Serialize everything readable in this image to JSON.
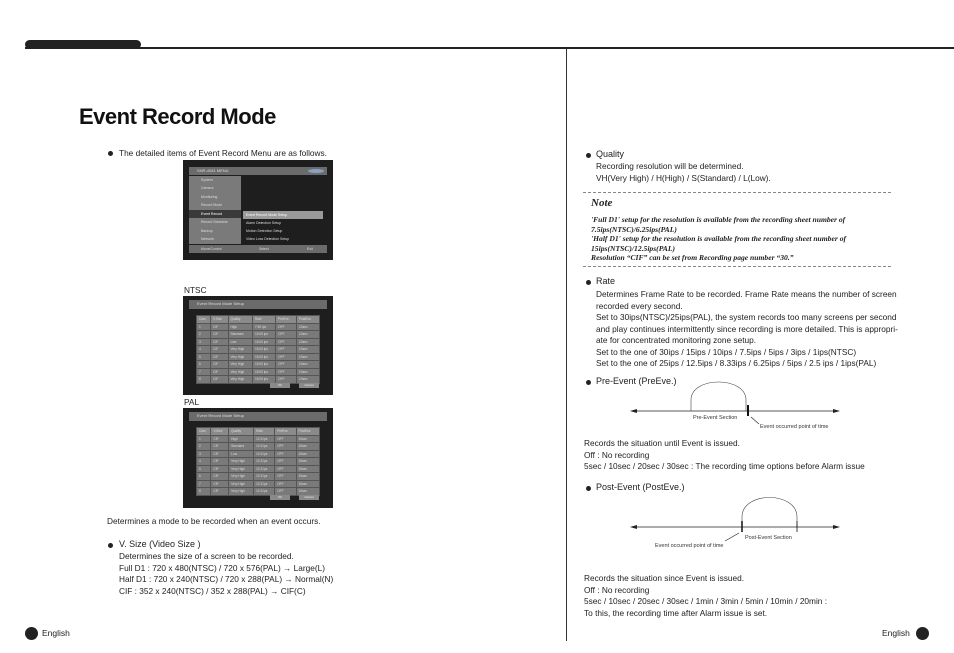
{
  "page": {
    "title": "Event Record Mode",
    "footer_left": "English",
    "footer_right": "English"
  },
  "left": {
    "intro": "The detailed items of Event Record Menu are as follows.",
    "ntsc_label": "NTSC",
    "pal_label": "PAL",
    "determines": "Determines a mode to be recorded when an event occurs.",
    "vsize_title": "V. Size (Video Size )",
    "vsize_lines": [
      "Determines the size of a screen to be recorded.",
      "Full D1 : 720 x 480(NTSC) / 720 x 576(PAL) → Large(L)",
      "Half D1 : 720 x 240(NTSC) / 720 x 288(PAL)  → Normal(N)",
      "CIF : 352 x 240(NTSC) / 352 x 288(PAL) → CIF(C)"
    ]
  },
  "menu_screen": {
    "title": "SHR-4081 MENU",
    "items": [
      "System",
      "Camera",
      "Monitoring",
      "Record Mode",
      "Event Record",
      "Record Schedule",
      "Backup",
      "Network"
    ],
    "selected": "Event Record",
    "submenu": [
      "Event Record Mode Setup",
      "Alarm Detection Setup",
      "Motion Detection Setup",
      "Video Loss Detection Setup"
    ],
    "footer": [
      "Move/Control",
      "Select",
      "Exit"
    ]
  },
  "setup_screens": {
    "title": "Event Record Mode Setup",
    "columns": [
      "Cam",
      "V.Size",
      "Quality",
      "Rate",
      "PreEve.",
      "PostEve."
    ],
    "ok": "OK",
    "cancel": "Cancel",
    "ntsc_rows": [
      [
        "1",
        "CIF",
        "High",
        "7.50 ips",
        "OFF",
        "10sec"
      ],
      [
        "2",
        "CIF",
        "Standard",
        "15.00 ips",
        "OFF",
        "10sec"
      ],
      [
        "3",
        "CIF",
        "Low",
        "15.00 ips",
        "OFF",
        "10sec"
      ],
      [
        "4",
        "CIF",
        "Very High",
        "15.00 ips",
        "OFF",
        "10sec"
      ],
      [
        "5",
        "CIF",
        "Very High",
        "15.00 ips",
        "OFF",
        "10sec"
      ],
      [
        "6",
        "CIF",
        "Very High",
        "15.00 ips",
        "OFF",
        "10sec"
      ],
      [
        "7",
        "CIF",
        "Very High",
        "15.00 ips",
        "OFF",
        "10sec"
      ],
      [
        "8",
        "CIF",
        "Very High",
        "15.00 ips",
        "OFF",
        "10sec"
      ]
    ],
    "pal_rows": [
      [
        "1",
        "CIF",
        "High",
        "12.5 ips",
        "OFF",
        "10sec"
      ],
      [
        "2",
        "CIF",
        "Standard",
        "12.5 ips",
        "OFF",
        "10sec"
      ],
      [
        "3",
        "CIF",
        "Low",
        "12.5 ips",
        "OFF",
        "10sec"
      ],
      [
        "4",
        "CIF",
        "Very High",
        "12.5 ips",
        "OFF",
        "10sec"
      ],
      [
        "5",
        "CIF",
        "Very High",
        "12.5 ips",
        "OFF",
        "10sec"
      ],
      [
        "6",
        "CIF",
        "Very High",
        "12.5 ips",
        "OFF",
        "10sec"
      ],
      [
        "7",
        "CIF",
        "Very High",
        "12.5 ips",
        "OFF",
        "10sec"
      ],
      [
        "8",
        "CIF",
        "Very High",
        "12.5 ips",
        "OFF",
        "10sec"
      ]
    ]
  },
  "right": {
    "quality_title": "Quality",
    "quality_lines": [
      "Recording resolution will be determined.",
      "VH(Very High) / H(High) / S(Standard) / L(Low)."
    ],
    "note_title": "Note",
    "note_lines": [
      "'Full D1' setup for the resolution is available from the recording sheet number of",
      "7.5ips(NTSC)/6.25ips(PAL)",
      "'Half D1' setup for the resolution is available from the recording sheet number of",
      "15ips(NTSC)/12.5ips(PAL)",
      "Resolution “CIF” can be set from Recording page number “30.”"
    ],
    "rate_title": "Rate",
    "rate_lines": [
      "Determines Frame Rate to be recorded. Frame Rate means the number of screen",
      "recorded every second.",
      "Set to 30ips(NTSC)/25ips(PAL), the system records too many screens per second",
      "and play continues intermittently since recording is more detailed. This is appropri-",
      "ate for concentrated monitoring zone setup.",
      "Set to the one of 30ips / 15ips / 10ips / 7.5ips / 5ips / 3ips / 1ips(NTSC)",
      "Set to the one of 25ips / 12.5ips / 8.33ips / 6.25ips / 5ips / 2.5 ips / 1ips(PAL)"
    ],
    "pre_title": "Pre-Event (PreEve.)",
    "pre_section": "Pre-Event Section",
    "pre_event_point": "Event occurred point of time",
    "pre_lines": [
      "Records the situation until Event is issued.",
      "Off : No recording",
      "5sec / 10sec / 20sec / 30sec : The recording time options before Alarm issue"
    ],
    "post_title": "Post-Event (PostEve.)",
    "post_section": "Post-Event Section",
    "post_event_point": "Event occurred point of time",
    "post_lines": [
      "Records the situation since Event is issued.",
      "Off : No recording",
      "5sec / 10sec / 20sec / 30sec / 1min / 3min / 5min / 10min / 20min :",
      "To this, the recording time after Alarm issue is set."
    ]
  }
}
